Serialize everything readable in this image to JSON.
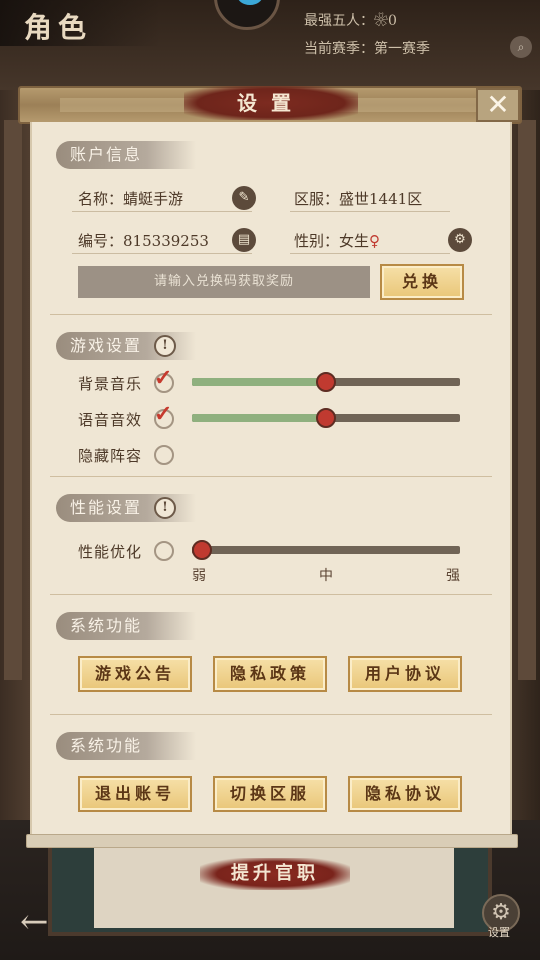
{
  "header": {
    "title": "角色",
    "strongest_five_label": "最强五人：",
    "strongest_five_value": "0",
    "season_label": "当前赛季：",
    "season_value": "第一赛季"
  },
  "dialog": {
    "title": "设置",
    "close_label": "✕"
  },
  "account": {
    "section_title": "账户信息",
    "name_label": "名称：",
    "name_value": "蜻蜓手游",
    "server_label": "区服：",
    "server_value": "盛世1441区",
    "id_label": "编号：",
    "id_value": "815339253",
    "gender_label": "性别：",
    "gender_value": "女生",
    "redeem_placeholder": "请输入兑换码获取奖励",
    "redeem_button": "兑换"
  },
  "game_settings": {
    "section_title": "游戏设置",
    "rows": [
      {
        "label": "背景音乐",
        "checked": true,
        "slider": 0.5
      },
      {
        "label": "语音音效",
        "checked": true,
        "slider": 0.5
      },
      {
        "label": "隐藏阵容",
        "checked": false
      }
    ]
  },
  "performance": {
    "section_title": "性能设置",
    "label": "性能优化",
    "checked": false,
    "slider": 0,
    "ticks": [
      "弱",
      "中",
      "强"
    ]
  },
  "system1": {
    "section_title": "系统功能",
    "buttons": [
      "游戏公告",
      "隐私政策",
      "用户协议"
    ]
  },
  "system2": {
    "section_title": "系统功能",
    "buttons": [
      "退出账号",
      "切换区服",
      "隐私协议"
    ]
  },
  "footer": {
    "promote_label": "提升官职",
    "settings_label": "设置"
  },
  "colors": {
    "accent_red": "#c03a30",
    "slider_fill": "#8fb07e",
    "gold_button": "#e9c678"
  }
}
